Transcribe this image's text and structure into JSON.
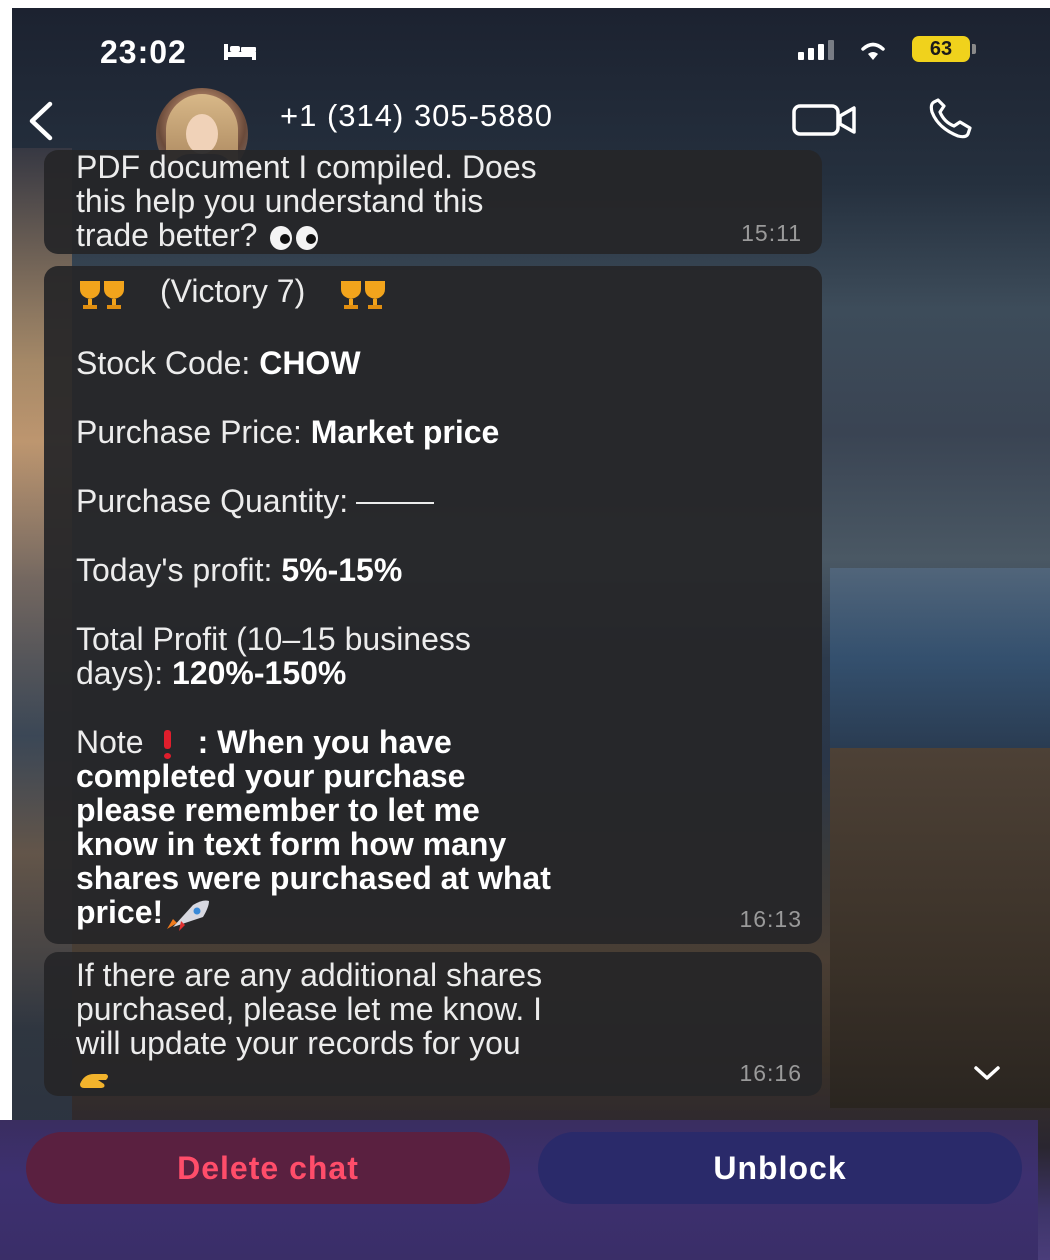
{
  "status_bar": {
    "time": "23:02",
    "battery_level": "63"
  },
  "header": {
    "back_icon": "chevron-left-icon",
    "contact_name": "+1 (314) 305-5880",
    "video_icon": "video-camera-icon",
    "phone_icon": "phone-icon"
  },
  "messages": [
    {
      "lines": [
        "PDF document I compiled. Does",
        "this help you understand this",
        "trade better?"
      ],
      "emoji": "eyes-icon",
      "time": "15:11"
    },
    {
      "title": "(Victory 7)",
      "stock_code_label": "Stock Code:",
      "stock_code_value": "CHOW",
      "price_label": "Purchase Price:",
      "price_value": "Market price",
      "quantity_label": "Purchase Quantity:",
      "today_label": "Today's profit:",
      "today_value": "5%-15%",
      "total_label_1": "Total Profit (10–15 business",
      "total_label_2": "days):",
      "total_value": "120%-150%",
      "note_label": "Note",
      "note_line_1": ": When you have",
      "note_line_2": "completed your purchase",
      "note_line_3": "please remember to let me",
      "note_line_4": "know in text form how many",
      "note_line_5": "shares were purchased at what",
      "note_line_6": "price!",
      "time": "16:13"
    },
    {
      "lines": [
        "If there are any additional shares",
        "purchased, please let me know. I",
        "will update your records for you"
      ],
      "emoji": "writing-hand-icon",
      "time": "16:16"
    }
  ],
  "actions": {
    "delete_label": "Delete chat",
    "unblock_label": "Unblock"
  },
  "colors": {
    "delete_text": "#ff4d6a",
    "battery": "#f0d21c",
    "bubble": "#262628"
  }
}
